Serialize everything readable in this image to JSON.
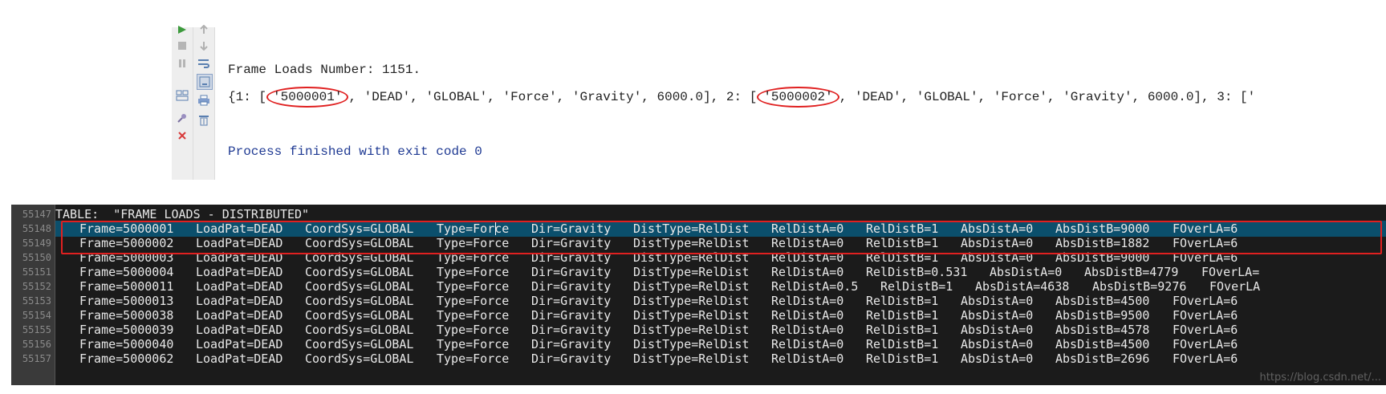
{
  "console": {
    "frame_count_line": "Frame Loads Number: 1151.",
    "dict_prefix": "{1: [",
    "dict_id_1": "'5000001'",
    "dict_mid_1": ", 'DEAD', 'GLOBAL', 'Force', 'Gravity', 6000.0], 2: [",
    "dict_id_2": "'5000002'",
    "dict_mid_2": ", 'DEAD', 'GLOBAL', 'Force', 'Gravity', 6000.0], 3: ['",
    "exit_line": "Process finished with exit code 0"
  },
  "toolbar": {
    "left_icons": [
      "run-icon",
      "stop-icon",
      "pause-icon",
      "layout-icon",
      "pin-icon",
      "close-icon"
    ],
    "right_icons": [
      "up-arrow-icon",
      "down-arrow-icon",
      "soft-wrap-icon",
      "scroll-to-end-icon",
      "print-icon",
      "trash-icon"
    ]
  },
  "editor": {
    "line_numbers": [
      "55147",
      "55148",
      "55149",
      "55150",
      "55151",
      "55152",
      "55153",
      "55154",
      "55155",
      "55156",
      "55157"
    ],
    "header_line": "TABLE:  \"FRAME LOADS - DISTRIBUTED\"",
    "rows": [
      [
        "Frame=5000001",
        "LoadPat=DEAD",
        "CoordSys=GLOBAL",
        "Type=Force",
        "Dir=Gravity",
        "DistType=RelDist",
        "RelDistA=0",
        "RelDistB=1",
        "AbsDistA=0",
        "AbsDistB=9000",
        "FOverLA=6"
      ],
      [
        "Frame=5000002",
        "LoadPat=DEAD",
        "CoordSys=GLOBAL",
        "Type=Force",
        "Dir=Gravity",
        "DistType=RelDist",
        "RelDistA=0",
        "RelDistB=1",
        "AbsDistA=0",
        "AbsDistB=1882",
        "FOverLA=6"
      ],
      [
        "Frame=5000003",
        "LoadPat=DEAD",
        "CoordSys=GLOBAL",
        "Type=Force",
        "Dir=Gravity",
        "DistType=RelDist",
        "RelDistA=0",
        "RelDistB=1",
        "AbsDistA=0",
        "AbsDistB=9000",
        "FOverLA=6"
      ],
      [
        "Frame=5000004",
        "LoadPat=DEAD",
        "CoordSys=GLOBAL",
        "Type=Force",
        "Dir=Gravity",
        "DistType=RelDist",
        "RelDistA=0",
        "RelDistB=0.531",
        "AbsDistA=0",
        "AbsDistB=4779",
        "FOverLA="
      ],
      [
        "Frame=5000011",
        "LoadPat=DEAD",
        "CoordSys=GLOBAL",
        "Type=Force",
        "Dir=Gravity",
        "DistType=RelDist",
        "RelDistA=0.5",
        "RelDistB=1",
        "AbsDistA=4638",
        "AbsDistB=9276",
        "FOverLA"
      ],
      [
        "Frame=5000013",
        "LoadPat=DEAD",
        "CoordSys=GLOBAL",
        "Type=Force",
        "Dir=Gravity",
        "DistType=RelDist",
        "RelDistA=0",
        "RelDistB=1",
        "AbsDistA=0",
        "AbsDistB=4500",
        "FOverLA=6"
      ],
      [
        "Frame=5000038",
        "LoadPat=DEAD",
        "CoordSys=GLOBAL",
        "Type=Force",
        "Dir=Gravity",
        "DistType=RelDist",
        "RelDistA=0",
        "RelDistB=1",
        "AbsDistA=0",
        "AbsDistB=9500",
        "FOverLA=6"
      ],
      [
        "Frame=5000039",
        "LoadPat=DEAD",
        "CoordSys=GLOBAL",
        "Type=Force",
        "Dir=Gravity",
        "DistType=RelDist",
        "RelDistA=0",
        "RelDistB=1",
        "AbsDistA=0",
        "AbsDistB=4578",
        "FOverLA=6"
      ],
      [
        "Frame=5000040",
        "LoadPat=DEAD",
        "CoordSys=GLOBAL",
        "Type=Force",
        "Dir=Gravity",
        "DistType=RelDist",
        "RelDistA=0",
        "RelDistB=1",
        "AbsDistA=0",
        "AbsDistB=4500",
        "FOverLA=6"
      ],
      [
        "Frame=5000062",
        "LoadPat=DEAD",
        "CoordSys=GLOBAL",
        "Type=Force",
        "Dir=Gravity",
        "DistType=RelDist",
        "RelDistA=0",
        "RelDistB=1",
        "AbsDistA=0",
        "AbsDistB=2696",
        "FOverLA=6"
      ]
    ],
    "watermark": "https://blog.csdn.net/..."
  },
  "colors": {
    "editor_bg": "#1b1b1b",
    "selection": "#0b4f6c",
    "annotation_red": "#e02020",
    "console_link_blue": "#1f3a93"
  }
}
